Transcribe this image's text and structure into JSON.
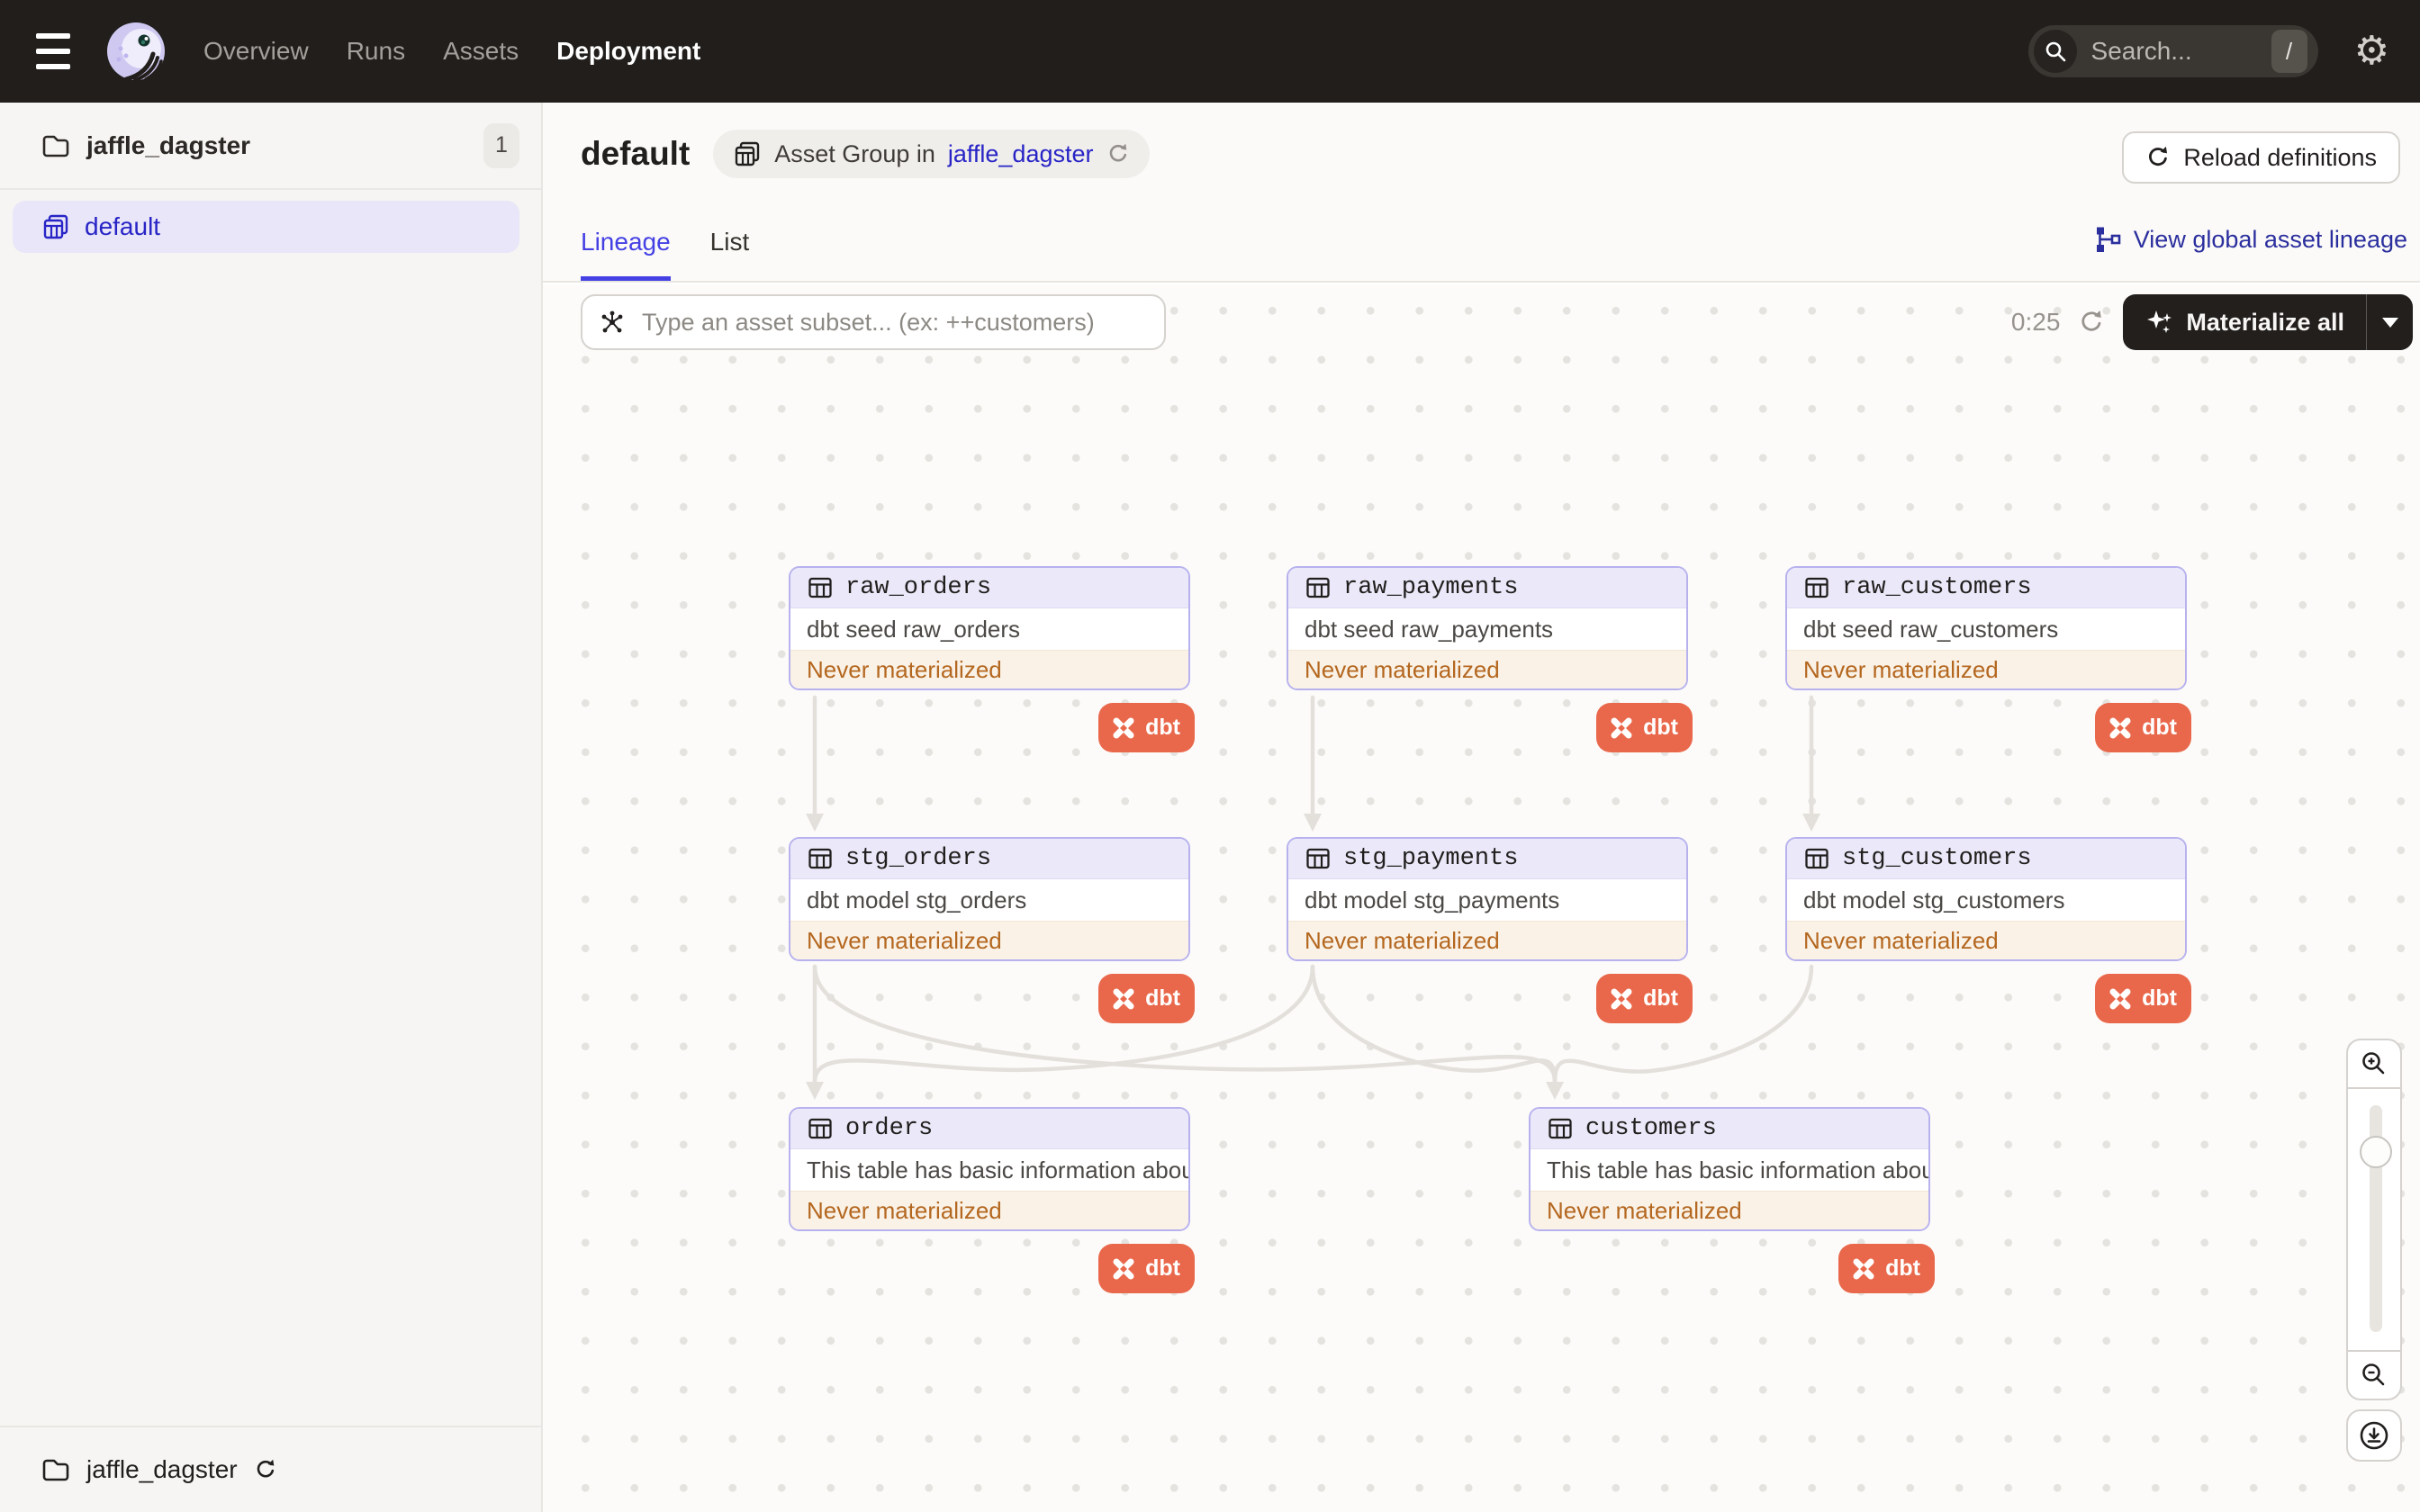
{
  "topbar": {
    "nav": [
      {
        "label": "Overview",
        "active": false
      },
      {
        "label": "Runs",
        "active": false
      },
      {
        "label": "Assets",
        "active": false
      },
      {
        "label": "Deployment",
        "active": true
      }
    ],
    "search": {
      "placeholder": "Search...",
      "shortcut": "/"
    }
  },
  "sidebar": {
    "code_location": {
      "name": "jaffle_dagster",
      "count": "1"
    },
    "group": {
      "label": "default"
    },
    "footer": {
      "name": "jaffle_dagster"
    }
  },
  "page_header": {
    "title": "default",
    "context_badge": {
      "prefix": "Asset Group in",
      "link": "jaffle_dagster"
    },
    "reload_button": "Reload definitions",
    "tabs": [
      {
        "label": "Lineage",
        "active": true
      },
      {
        "label": "List",
        "active": false
      }
    ],
    "global_lineage_link": "View global asset lineage"
  },
  "graph_toolbar": {
    "filter_placeholder": "Type an asset subset... (ex: ++customers)",
    "timer": "0:25",
    "materialize_label": "Materialize all"
  },
  "nodes": [
    {
      "id": "raw_orders",
      "name": "raw_orders",
      "description": "dbt seed raw_orders",
      "status": "Never materialized",
      "tag": "dbt"
    },
    {
      "id": "raw_payments",
      "name": "raw_payments",
      "description": "dbt seed raw_payments",
      "status": "Never materialized",
      "tag": "dbt"
    },
    {
      "id": "raw_customers",
      "name": "raw_customers",
      "description": "dbt seed raw_customers",
      "status": "Never materialized",
      "tag": "dbt"
    },
    {
      "id": "stg_orders",
      "name": "stg_orders",
      "description": "dbt model stg_orders",
      "status": "Never materialized",
      "tag": "dbt"
    },
    {
      "id": "stg_payments",
      "name": "stg_payments",
      "description": "dbt model stg_payments",
      "status": "Never materialized",
      "tag": "dbt"
    },
    {
      "id": "stg_customers",
      "name": "stg_customers",
      "description": "dbt model stg_customers",
      "status": "Never materialized",
      "tag": "dbt"
    },
    {
      "id": "orders",
      "name": "orders",
      "description": "This table has basic information about ...",
      "status": "Never materialized",
      "tag": "dbt"
    },
    {
      "id": "customers",
      "name": "customers",
      "description": "This table has basic information about ...",
      "status": "Never materialized",
      "tag": "dbt"
    }
  ],
  "colors": {
    "topbar_bg": "#211E1C",
    "accent_blue": "#2824C6",
    "tab_blue": "#4440E4",
    "link_navy": "#2B2F9E",
    "dbt_orange": "#E9684B",
    "status_orange": "#B4671F",
    "node_border": "#B7B2EE",
    "node_header_bg": "#EBE9F9",
    "status_bg": "#FAF2E7",
    "edge_gray": "#E3E0DC"
  }
}
